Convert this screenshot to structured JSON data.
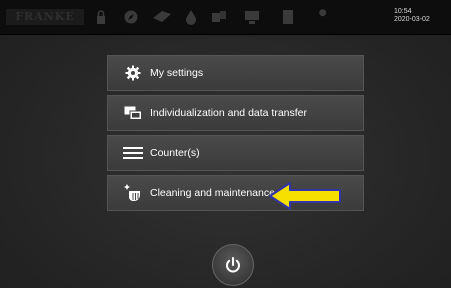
{
  "header": {
    "brand": "FRANKE",
    "time": "10:54",
    "date": "2020-03-02",
    "status_icons": [
      "padlock-icon",
      "compass-icon",
      "tag-icon",
      "drop-icon",
      "cup-transfer-icon",
      "display-icon",
      "document-icon",
      "wrench-icon"
    ]
  },
  "menu": {
    "items": [
      {
        "label": "My settings",
        "icon": "gear-icon"
      },
      {
        "label": "Individualization and data transfer",
        "icon": "screens-icon"
      },
      {
        "label": "Counter(s)",
        "icon": "list-icon"
      },
      {
        "label": "Cleaning and maintenance",
        "icon": "hand-cleaning-icon"
      }
    ]
  },
  "annotation": {
    "color": "#f5e000",
    "outline": "#3333aa"
  },
  "colors": {
    "background": "#262626",
    "button": "#444444",
    "text": "#ffffff"
  }
}
